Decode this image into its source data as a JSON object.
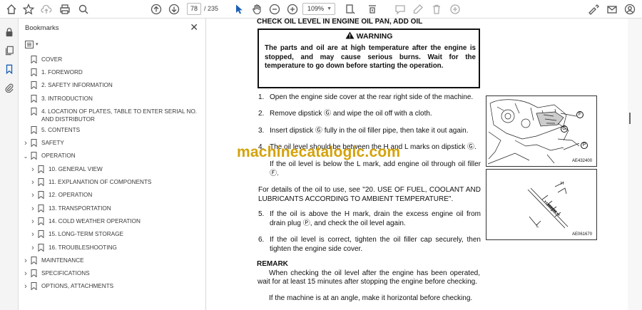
{
  "toolbar": {
    "page_current": "78",
    "page_total": "/ 235",
    "zoom": "109%"
  },
  "bookmarks": {
    "title": "Bookmarks",
    "items": [
      {
        "label": "COVER",
        "expandable": false,
        "indent": 0
      },
      {
        "label": "1. FOREWORD",
        "expandable": false,
        "indent": 0
      },
      {
        "label": "2. SAFETY INFORMATION",
        "expandable": false,
        "indent": 0
      },
      {
        "label": "3. INTRODUCTION",
        "expandable": false,
        "indent": 0
      },
      {
        "label": "4. LOCATION OF PLATES, TABLE TO ENTER SERIAL NO. AND DISTRIBUTOR",
        "expandable": false,
        "indent": 0
      },
      {
        "label": "5. CONTENTS",
        "expandable": false,
        "indent": 0
      },
      {
        "label": "SAFETY",
        "expandable": true,
        "expanded": false,
        "indent": 0
      },
      {
        "label": "OPERATION",
        "expandable": true,
        "expanded": true,
        "indent": 0
      },
      {
        "label": "10. GENERAL VIEW",
        "expandable": true,
        "expanded": false,
        "indent": 1
      },
      {
        "label": "11. EXPLANATION OF COMPONENTS",
        "expandable": true,
        "expanded": false,
        "indent": 1
      },
      {
        "label": "12. OPERATION",
        "expandable": true,
        "expanded": false,
        "indent": 1
      },
      {
        "label": "13. TRANSPORTATION",
        "expandable": true,
        "expanded": false,
        "indent": 1
      },
      {
        "label": "14. COLD WEATHER OPERATION",
        "expandable": true,
        "expanded": false,
        "indent": 1
      },
      {
        "label": "15. LONG-TERM STORAGE",
        "expandable": true,
        "expanded": false,
        "indent": 1
      },
      {
        "label": "16. TROUBLESHOOTING",
        "expandable": true,
        "expanded": false,
        "indent": 1
      },
      {
        "label": "MAINTENANCE",
        "expandable": true,
        "expanded": false,
        "indent": 0
      },
      {
        "label": "SPECIFICATIONS",
        "expandable": true,
        "expanded": false,
        "indent": 0
      },
      {
        "label": "OPTIONS, ATTACHMENTS",
        "expandable": true,
        "expanded": false,
        "indent": 0
      }
    ]
  },
  "document": {
    "heading": "CHECK OIL LEVEL IN ENGINE OIL PAN, ADD OIL",
    "warning_title": "WARNING",
    "warning_text": "The parts and oil are at high temperature after the engine is stopped, and may cause serious burns. Wait for the temperature to go down before starting the operation.",
    "steps": [
      {
        "num": "1.",
        "text": "Open the engine  side cover at the rear right side of the machine."
      },
      {
        "num": "2.",
        "text": "Remove dipstick Ⓖ and wipe the oil off with a cloth."
      },
      {
        "num": "3.",
        "text": "Insert dipstick Ⓖ fully in the oil filler pipe, then take it out again."
      },
      {
        "num": "4.",
        "text": "The oil level should be between the H and L marks on dipstick Ⓖ."
      },
      {
        "num": "",
        "text": "If the oil level is below the L mark, add engine oil through oil filler Ⓕ."
      },
      {
        "num": "",
        "text": "For details of the oil to use, see \"20. USE OF FUEL, COOLANT AND LUBRICANTS ACCORDING TO AMBIENT TEMPERATURE\"."
      },
      {
        "num": "5.",
        "text": "If the oil is above the H mark, drain the excess engine oil from drain plug Ⓟ, and check the oil level again."
      },
      {
        "num": "6.",
        "text": "If the oil level is correct, tighten the oil filler cap securely, then tighten the engine side cover."
      }
    ],
    "remark_title": "REMARK",
    "remark_1": "When checking the oil level after the engine has been operated, wait for at least 15 minutes after stopping the engine before checking.",
    "remark_2": "If the machine is at an angle, make it horizontal before checking.",
    "fig1_code": "AE432400",
    "fig2_code": "AE061670",
    "fig_label_f": "F",
    "fig_label_g": "G",
    "fig_label_p": "P",
    "fig_label_h": "H",
    "fig_label_l": "L",
    "watermark": "machinecatalogic.com"
  }
}
